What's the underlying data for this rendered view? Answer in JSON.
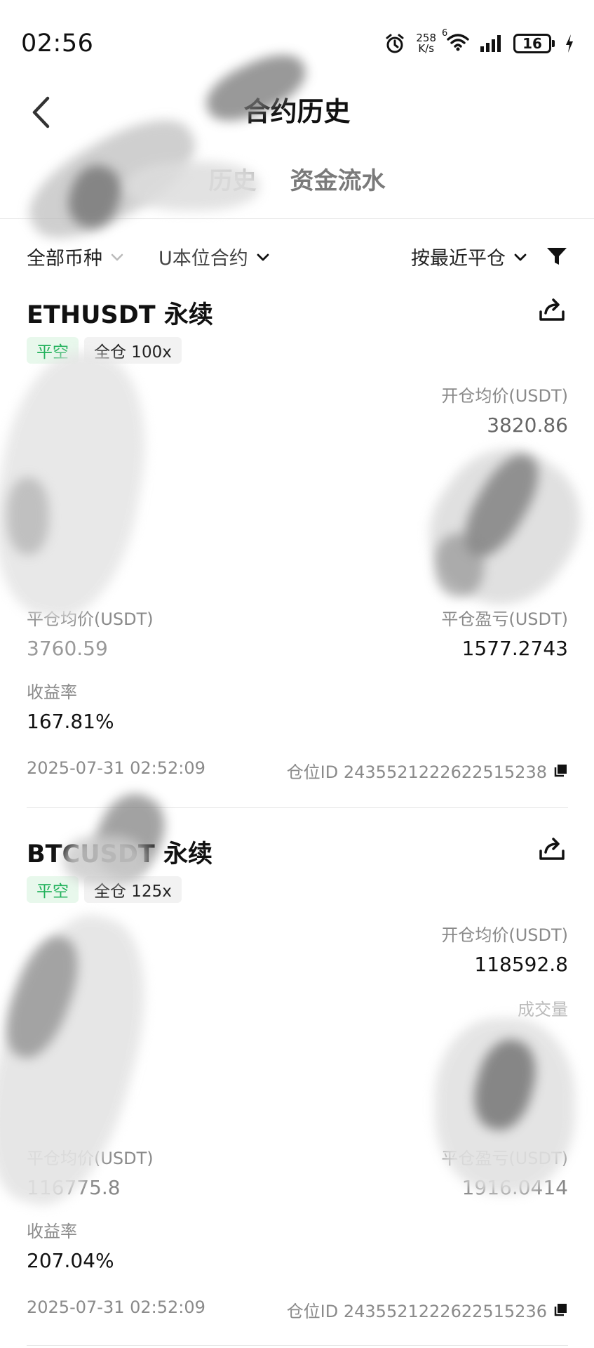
{
  "status_bar": {
    "time": "02:56",
    "speed_value": "258",
    "speed_unit": "K/s",
    "wifi_badge": "6",
    "battery": "16",
    "icons": [
      "alarm-icon",
      "wifi-icon",
      "signal-icon",
      "battery-icon",
      "charging-icon"
    ]
  },
  "header": {
    "title": "合约历史",
    "tabs": [
      "历史",
      "资金流水"
    ]
  },
  "filters": {
    "coin": "全部币种",
    "contract": "U本位合约",
    "sort": "按最近平仓",
    "icons": [
      "chevron-down-icon",
      "filter-icon"
    ]
  },
  "positions": [
    {
      "symbol": "ETHUSDT 永续",
      "status_tag": "平空",
      "margin_tag": "全仓 100x",
      "open_avg_label": "开仓均价(USDT)",
      "open_avg_value": "3820.86",
      "close_avg_label": "平仓均价(USDT)",
      "close_avg_value": "3760.59",
      "pnl_label": "平仓盈亏(USDT)",
      "pnl_value": "1577.2743",
      "roi_label": "收益率",
      "roi_value": "167.81%",
      "date": "2025-07-31 02:52:09",
      "position_id": "仓位ID 2435521222622515238"
    },
    {
      "symbol": "BTCUSDT 永续",
      "status_tag": "平空",
      "margin_tag": "全仓 125x",
      "open_avg_label": "开仓均价(USDT)",
      "open_avg_value": "118592.8",
      "fill_label": "成交量",
      "close_avg_label": "平仓均价(USDT)",
      "close_avg_value": "116775.8",
      "pnl_label": "平仓盈亏(USDT)",
      "pnl_value": "1916.0414",
      "roi_label": "收益率",
      "roi_value": "207.04%",
      "date": "2025-07-31 02:52:09",
      "position_id": "仓位ID 2435521222622515236"
    }
  ],
  "colors": {
    "accent_green": "#20b15a",
    "tag_green_bg": "#e8f8ec",
    "text_primary": "#111111",
    "text_secondary": "#8a8a8a"
  }
}
